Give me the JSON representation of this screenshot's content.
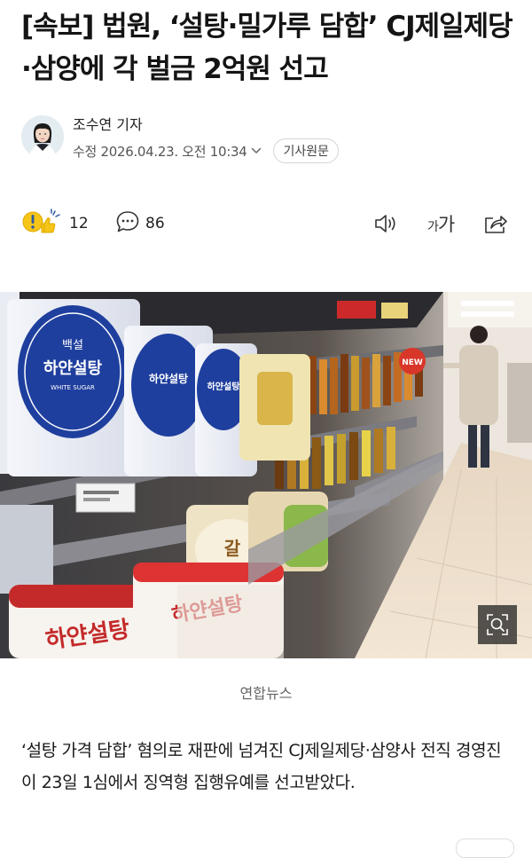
{
  "article": {
    "headline": "[속보] 법원, ‘설탕·밀가루 담합’ CJ제일제당·삼양에 각 벌금 2억원 선고",
    "reporter": "조수연 기자",
    "edited": "수정 2026.04.23. 오전 10:34",
    "original_button": "기사원문",
    "photo_credit": "연합뉴스",
    "body": "‘설탕 가격 담합’ 혐의로 재판에 넘겨진 CJ제일제당·삼양사 전직 경영진이 23일 1심에서 징역형 집행유예를 선고받았다."
  },
  "actions": {
    "reaction_count": "12",
    "comment_count": "86",
    "font_size_label_small": "가",
    "font_size_label_large": "가"
  },
  "photo": {
    "bag_labels": [
      "백설",
      "하얀설탕",
      "WHITE SUGAR"
    ],
    "sign_label": "NEW"
  },
  "icons": {
    "reaction": "reaction-emoji-icon",
    "comment": "speech-bubble-icon",
    "audio": "speaker-icon",
    "font_size": "font-size-icon",
    "share": "share-icon",
    "zoom": "zoom-icon",
    "chevron": "chevron-down-icon"
  },
  "colors": {
    "text": "#141414",
    "meta": "#555555",
    "sugar_blue": "#1f3f9e",
    "reaction_yellow": "#f5c518"
  }
}
